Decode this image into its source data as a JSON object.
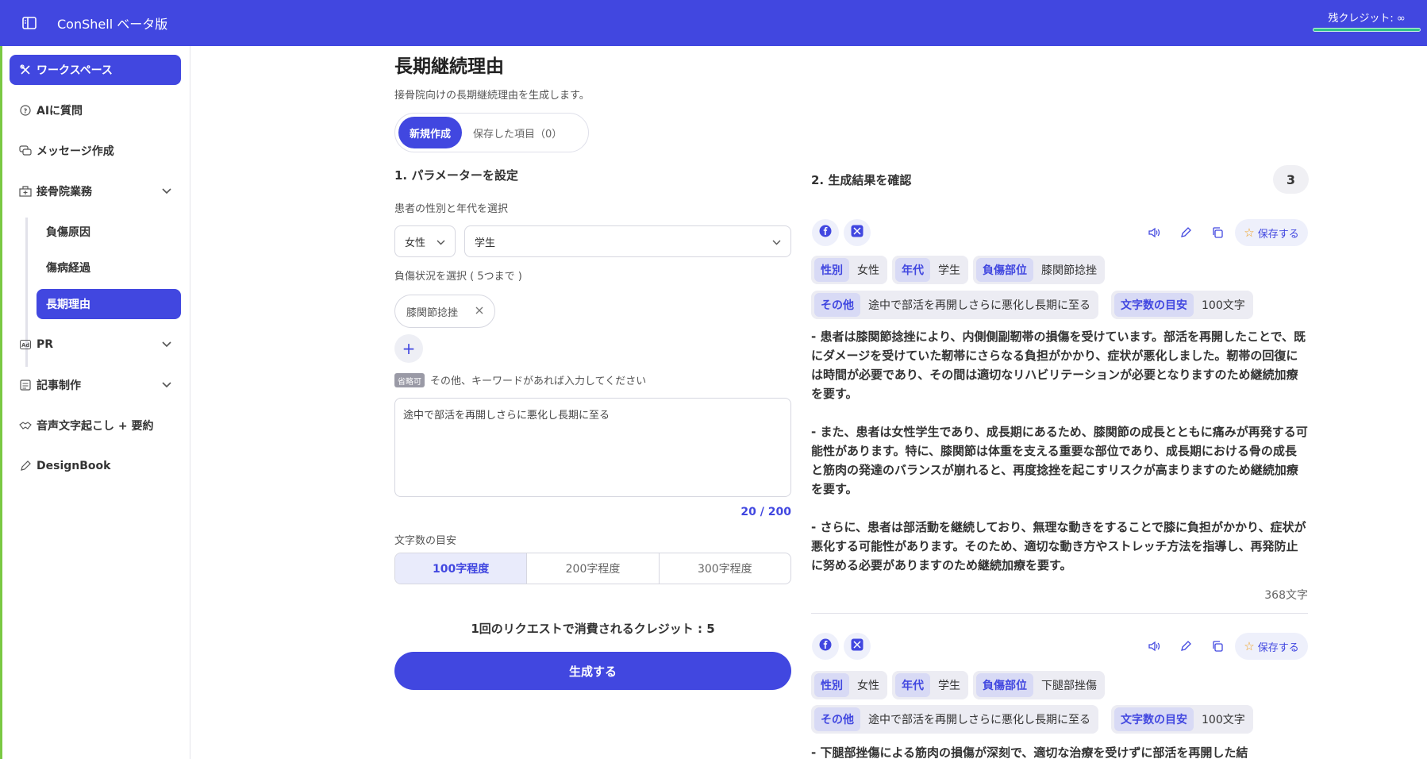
{
  "header": {
    "brand": "ConShell ベータ版",
    "credit_label": "残クレジット: ∞"
  },
  "sidebar": {
    "items": [
      {
        "label": "ワークスペース",
        "icon": "tools-icon"
      },
      {
        "label": "AIに質問",
        "icon": "chat-question-icon"
      },
      {
        "label": "メッセージ作成",
        "icon": "messages-icon"
      },
      {
        "label": "接骨院業務",
        "icon": "clinic-icon"
      },
      {
        "label": "PR",
        "icon": "ad-icon"
      },
      {
        "label": "記事制作",
        "icon": "article-icon"
      },
      {
        "label": "音声文字起こし + 要約",
        "icon": "handshake-icon"
      },
      {
        "label": "DesignBook",
        "icon": "pencil-icon"
      }
    ],
    "sub_items": [
      {
        "label": "負傷原因"
      },
      {
        "label": "傷病経過"
      },
      {
        "label": "長期理由"
      }
    ]
  },
  "main": {
    "title": "長期継続理由",
    "description": "接骨院向けの長期継続理由を生成します。",
    "tabs": [
      {
        "label": "新規作成"
      },
      {
        "label": "保存した項目（0）"
      }
    ],
    "params": {
      "section_title": "1. パラメーターを設定",
      "gender_age_label": "患者の性別と年代を選択",
      "gender_value": "女性",
      "age_value": "学生",
      "injury_label": "負傷状況を選択 ( 5つまで )",
      "injury_chip": "膝関節捻挫",
      "optional_badge": "省略可",
      "keyword_label": "その他、キーワードがあれば入力してください",
      "keyword_value": "途中で部活を再開しさらに悪化し長期に至る",
      "counter": "20 / 200",
      "length_label": "文字数の目安",
      "length_options": [
        "100字程度",
        "200字程度",
        "300字程度"
      ],
      "request_credit": "1回のリクエストで消費されるクレジット : 5",
      "generate_label": "生成する"
    },
    "results": {
      "section_title": "2. 生成結果を確認",
      "count": "3",
      "save_label": "保存する",
      "cards": [
        {
          "tags": {
            "gender_k": "性別",
            "gender_v": "女性",
            "age_k": "年代",
            "age_v": "学生",
            "part_k": "負傷部位",
            "part_v": "膝関節捻挫",
            "other_k": "その他",
            "other_v": "途中で部活を再開しさらに悪化し長期に至る",
            "len_k": "文字数の目安",
            "len_v": "100文字"
          },
          "text": "- 患者は膝関節捻挫により、内側側副靭帯の損傷を受けています。部活を再開したことで、既にダメージを受けていた靭帯にさらなる負担がかかり、症状が悪化しました。靭帯の回復には時間が必要であり、その間は適切なリハビリテーションが必要となりますのため継続加療を要す。\n\n- また、患者は女性学生であり、成長期にあるため、膝関節の成長とともに痛みが再発する可能性があります。特に、膝関節は体重を支える重要な部位であり、成長期における骨の成長と筋肉の発達のバランスが崩れると、再度捻挫を起こすリスクが高まりますのため継続加療を要す。\n\n- さらに、患者は部活動を継続しており、無理な動きをすることで膝に負担がかかり、症状が悪化する可能性があります。そのため、適切な動き方やストレッチ方法を指導し、再発防止に努める必要がありますのため継続加療を要す。",
          "char_count": "368文字"
        },
        {
          "tags": {
            "gender_k": "性別",
            "gender_v": "女性",
            "age_k": "年代",
            "age_v": "学生",
            "part_k": "負傷部位",
            "part_v": "下腿部挫傷",
            "other_k": "その他",
            "other_v": "途中で部活を再開しさらに悪化し長期に至る",
            "len_k": "文字数の目安",
            "len_v": "100文字"
          },
          "text": "- 下腿部挫傷による筋肉の損傷が深刻で、適切な治療を受けずに部活を再開した結"
        }
      ]
    }
  },
  "colors": {
    "accent": "#4147e0",
    "credit_bar": "#2fc38a",
    "star": "#f0a020"
  }
}
